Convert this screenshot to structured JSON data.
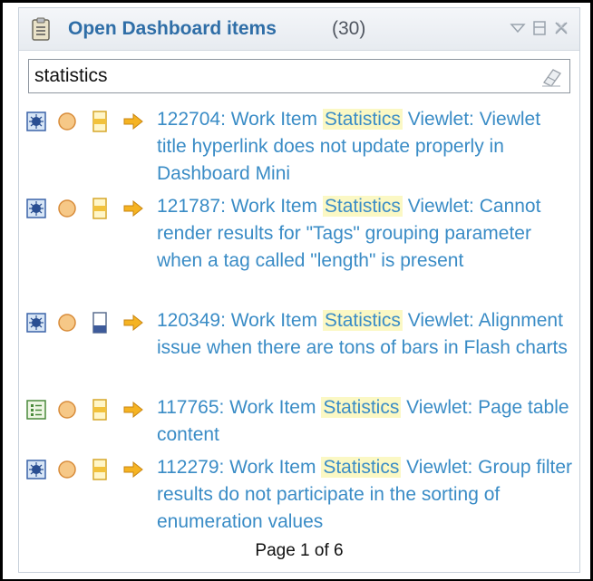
{
  "panel": {
    "title": "Open Dashboard items",
    "count": "(30)",
    "icons": {
      "title": "clipboard-icon",
      "minimize": "minimize-icon",
      "maximize": "maximize-icon",
      "close": "close-icon"
    }
  },
  "search": {
    "value": "statistics",
    "clear_icon": "eraser-icon"
  },
  "items": [
    {
      "pre": "122704: Work Item ",
      "hl": "Statistics",
      "post": " Viewlet: Viewlet title hyperlink does not update properly in Dashboard Mini",
      "type_icon": "defect-icon",
      "priority": "medium"
    },
    {
      "pre": "121787: Work Item ",
      "hl": "Statistics",
      "post": " Viewlet: Cannot render results for \"Tags\" grouping parameter when a tag called \"length\" is present",
      "type_icon": "defect-icon",
      "priority": "medium"
    },
    {
      "pre": "120349: Work Item ",
      "hl": "Statistics",
      "post": " Viewlet: Alignment issue when there are tons of bars in Flash charts",
      "type_icon": "defect-icon",
      "priority": "low"
    },
    {
      "pre": "117765: Work Item ",
      "hl": "Statistics",
      "post": " Viewlet: Page table content",
      "type_icon": "task-icon",
      "priority": "medium"
    },
    {
      "pre": "112279: Work Item ",
      "hl": "Statistics",
      "post": " Viewlet: Group filter results do not participate in the sorting of enumeration values",
      "type_icon": "defect-icon",
      "priority": "medium"
    }
  ],
  "footer": {
    "page": "Page 1 of 6"
  },
  "colors": {
    "accent": "#2f6ea7",
    "link": "#3a8cc6",
    "highlight": "#fbf8c4",
    "severity": "#f1b86a"
  }
}
